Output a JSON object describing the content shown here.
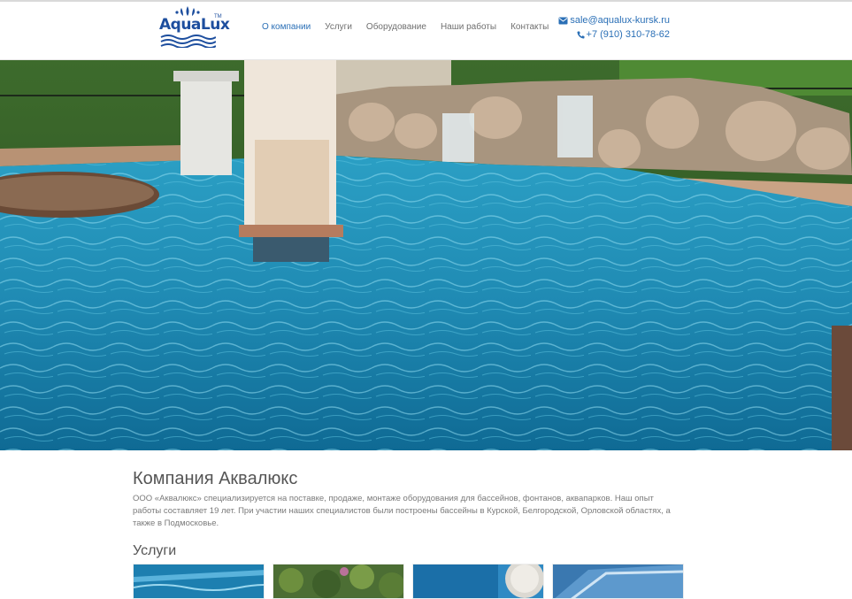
{
  "header": {
    "logo_text": "AquaLux",
    "logo_tm": "TM",
    "nav": [
      {
        "label": "О компании",
        "active": true
      },
      {
        "label": "Услуги",
        "active": false
      },
      {
        "label": "Оборудование",
        "active": false
      },
      {
        "label": "Наши работы",
        "active": false
      },
      {
        "label": "Контакты",
        "active": false
      }
    ],
    "email": "sale@aqualux-kursk.ru",
    "phone": "+7 (910) 310-78-62"
  },
  "hero": {
    "image": "pool-with-waterfall-photo"
  },
  "about": {
    "title": "Компания Аквалюкс",
    "text": "ООО «Аквалюкс» специализируется на поставке, продаже, монтаже оборудования для бассейнов, фонтанов, аквапарков. Наш опыт работы составляет 19 лет. При участии наших специалистов были построены бассейны в Курской, Белгородской, Орловской областях, а также в Подмосковье."
  },
  "services": {
    "title": "Услуги",
    "cards": [
      {
        "image": "pool-water-photo"
      },
      {
        "image": "garden-plants-photo"
      },
      {
        "image": "mosaic-pool-photo"
      },
      {
        "image": "water-slide-photo"
      }
    ]
  },
  "colors": {
    "accent": "#2a6fb6",
    "logo": "#1d4e9e",
    "water": "#1f8fb8"
  }
}
